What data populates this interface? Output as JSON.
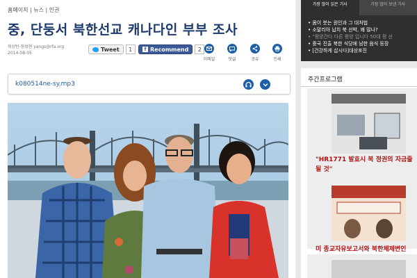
{
  "breadcrumb": "홈페이지 | 뉴스 | 인권",
  "headline": "중, 단둥서 북한선교 캐나다인 부부 조사",
  "meta": {
    "author": "워싱턴-장성현 yangs@rfa.org",
    "date": "2014-08-05"
  },
  "social": {
    "tweet_label": "Tweet",
    "tweet_count": "1",
    "recommend_label": "Recommend",
    "recommend_count": "2"
  },
  "actions": [
    {
      "label": "이메일",
      "icon": "email-icon"
    },
    {
      "label": "댓글",
      "icon": "comment-icon"
    },
    {
      "label": "공유",
      "icon": "share-icon"
    },
    {
      "label": "인쇄",
      "icon": "print-icon"
    }
  ],
  "audio": {
    "filename": "k080514ne-sy.mp3",
    "icons": [
      "headphones-icon",
      "download-icon"
    ]
  },
  "sidebar": {
    "tabs": [
      "가장 많이 읽은 기사",
      "가장 많이 보낸 기사"
    ],
    "news": [
      "몸이 붓는 원인과 그 대처법",
      "소말리아 납치 북 선박, 왜 많나?",
      "\"평양간다 다른 평양 입니다 50대 평 선",
      "중국 진출 북한 식당에 남한 음식 등장",
      "[건강하게 삽시다]대상포진"
    ],
    "program_heading": "주간프로그램",
    "cards": [
      {
        "caption": "\"HR1771 발효시 북 정권의 자금줄",
        "caption2": "될 것\""
      },
      {
        "caption": "미 종교자유보고서와 북한체제변인"
      },
      {
        "caption": ""
      }
    ]
  },
  "colors": {
    "headline": "#1d3a6c",
    "accent": "#1d5fa8",
    "sidebar_dark": "#2f2f2f",
    "caption_red": "#b01212"
  }
}
